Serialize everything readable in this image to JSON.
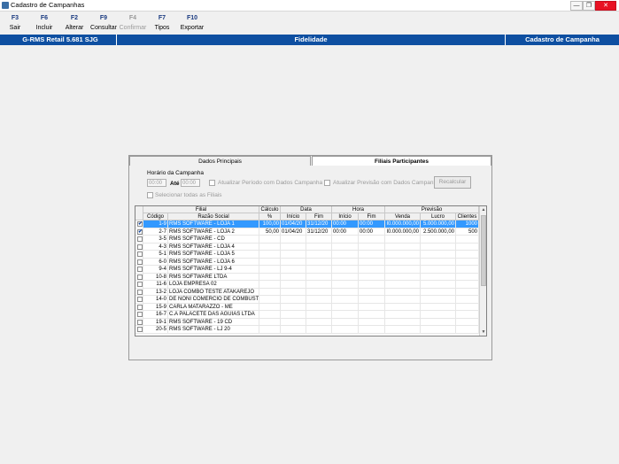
{
  "window": {
    "title": "Cadastro de Campanhas"
  },
  "toolbar": [
    {
      "key": "F3",
      "label": "Sair",
      "enabled": true
    },
    {
      "key": "F6",
      "label": "Incluir",
      "enabled": true
    },
    {
      "key": "F2",
      "label": "Alterar",
      "enabled": true
    },
    {
      "key": "F9",
      "label": "Consultar",
      "enabled": true
    },
    {
      "key": "F4",
      "label": "Confirmar",
      "enabled": false
    },
    {
      "key": "F7",
      "label": "Tipos",
      "enabled": true
    },
    {
      "key": "F10",
      "label": "Exportar",
      "enabled": true
    }
  ],
  "header": {
    "left": "G-RMS Retail 5.681 SJG",
    "center": "Fidelidade",
    "right": "Cadastro de Campanha",
    "color": "#0e4fa1"
  },
  "tabs": {
    "tab1": "Dados Principais",
    "tab2": "Filiais Participantes"
  },
  "form": {
    "horario_label": "Horário da Campanha",
    "horario_start": "00:00",
    "ate_label": "Até",
    "horario_end": "00:00",
    "atualizar_periodo": "Atualizar Período com Dados Campanha",
    "atualizar_previsao": "Atualizar Previsão com Dados Campanha",
    "recalcular": "Recalcular",
    "selecionar_todas": "Selecionar todas as Filiais"
  },
  "grid": {
    "group_headers": {
      "filial": "Filial",
      "calculo": "Cálculo",
      "data": "Data",
      "hora": "Hora",
      "previsao": "Previsão"
    },
    "columns": {
      "codigo": "Código",
      "razao": "Razão Social",
      "pct": "%",
      "inicio": "Início",
      "fim": "Fim",
      "hinicio": "Início",
      "hfim": "Fim",
      "venda": "Venda",
      "lucro": "Lucro",
      "clientes": "Clientes"
    },
    "rows": [
      {
        "checked": true,
        "selected": true,
        "codigo": "1-9",
        "razao": "RMS SOFTWARE - LOJA 1",
        "pct": "100,00",
        "inicio": "01/04/20",
        "fim": "31/12/20",
        "hinicio": "00:00",
        "hfim": "00:00",
        "venda": "l0.000.000,00",
        "lucro": "5.000.000,00",
        "clientes": "1000"
      },
      {
        "checked": true,
        "selected": false,
        "codigo": "2-7",
        "razao": "RMS SOFTWARE - LOJA 2",
        "pct": "50,00",
        "inicio": "01/04/20",
        "fim": "31/12/20",
        "hinicio": "00:00",
        "hfim": "00:00",
        "venda": "l0.000.000,00",
        "lucro": "2.500.000,00",
        "clientes": "500"
      },
      {
        "checked": false,
        "selected": false,
        "codigo": "3-5",
        "razao": "RMS SOFTWARE - CD",
        "pct": "",
        "inicio": "",
        "fim": "",
        "hinicio": "",
        "hfim": "",
        "venda": "",
        "lucro": "",
        "clientes": ""
      },
      {
        "checked": false,
        "selected": false,
        "codigo": "4-3",
        "razao": "RMS SOFTWARE - LOJA 4",
        "pct": "",
        "inicio": "",
        "fim": "",
        "hinicio": "",
        "hfim": "",
        "venda": "",
        "lucro": "",
        "clientes": ""
      },
      {
        "checked": false,
        "selected": false,
        "codigo": "5-1",
        "razao": "RMS SOFTWARE - LOJA 5",
        "pct": "",
        "inicio": "",
        "fim": "",
        "hinicio": "",
        "hfim": "",
        "venda": "",
        "lucro": "",
        "clientes": ""
      },
      {
        "checked": false,
        "selected": false,
        "codigo": "6-0",
        "razao": "RMS SOFTWARE - LOJA 6",
        "pct": "",
        "inicio": "",
        "fim": "",
        "hinicio": "",
        "hfim": "",
        "venda": "",
        "lucro": "",
        "clientes": ""
      },
      {
        "checked": false,
        "selected": false,
        "codigo": "9-4",
        "razao": "RMS SOFTWARE - LJ 9-4",
        "pct": "",
        "inicio": "",
        "fim": "",
        "hinicio": "",
        "hfim": "",
        "venda": "",
        "lucro": "",
        "clientes": ""
      },
      {
        "checked": false,
        "selected": false,
        "codigo": "10-8",
        "razao": "RMS SOFTWARE LTDA",
        "pct": "",
        "inicio": "",
        "fim": "",
        "hinicio": "",
        "hfim": "",
        "venda": "",
        "lucro": "",
        "clientes": ""
      },
      {
        "checked": false,
        "selected": false,
        "codigo": "11-6",
        "razao": "LOJA EMPRESA 02",
        "pct": "",
        "inicio": "",
        "fim": "",
        "hinicio": "",
        "hfim": "",
        "venda": "",
        "lucro": "",
        "clientes": ""
      },
      {
        "checked": false,
        "selected": false,
        "codigo": "13-2",
        "razao": "LOJA COMBO TESTE ATAKAREJO",
        "pct": "",
        "inicio": "",
        "fim": "",
        "hinicio": "",
        "hfim": "",
        "venda": "",
        "lucro": "",
        "clientes": ""
      },
      {
        "checked": false,
        "selected": false,
        "codigo": "14-0",
        "razao": "DE NONI COMERCIO DE COMBUSTI",
        "pct": "",
        "inicio": "",
        "fim": "",
        "hinicio": "",
        "hfim": "",
        "venda": "",
        "lucro": "",
        "clientes": ""
      },
      {
        "checked": false,
        "selected": false,
        "codigo": "15-9",
        "razao": "CARLA MATARAZZO - ME",
        "pct": "",
        "inicio": "",
        "fim": "",
        "hinicio": "",
        "hfim": "",
        "venda": "",
        "lucro": "",
        "clientes": ""
      },
      {
        "checked": false,
        "selected": false,
        "codigo": "16-7",
        "razao": "C.A PALACETE DAS AGUIAS LTDA",
        "pct": "",
        "inicio": "",
        "fim": "",
        "hinicio": "",
        "hfim": "",
        "venda": "",
        "lucro": "",
        "clientes": ""
      },
      {
        "checked": false,
        "selected": false,
        "codigo": "19-1",
        "razao": "RMS SOFTWARE - 19 CD",
        "pct": "",
        "inicio": "",
        "fim": "",
        "hinicio": "",
        "hfim": "",
        "venda": "",
        "lucro": "",
        "clientes": ""
      },
      {
        "checked": false,
        "selected": false,
        "codigo": "20-5",
        "razao": "RMS SOFTWARE - LJ 20",
        "pct": "",
        "inicio": "",
        "fim": "",
        "hinicio": "",
        "hfim": "",
        "venda": "",
        "lucro": "",
        "clientes": ""
      }
    ]
  },
  "icons": {
    "app": "app-icon",
    "minimize": "minimize-icon",
    "maximize": "maximize-icon",
    "close": "close-icon",
    "check": "check-icon",
    "scroll_up": "arrow-up-icon",
    "scroll_down": "arrow-down-icon"
  }
}
